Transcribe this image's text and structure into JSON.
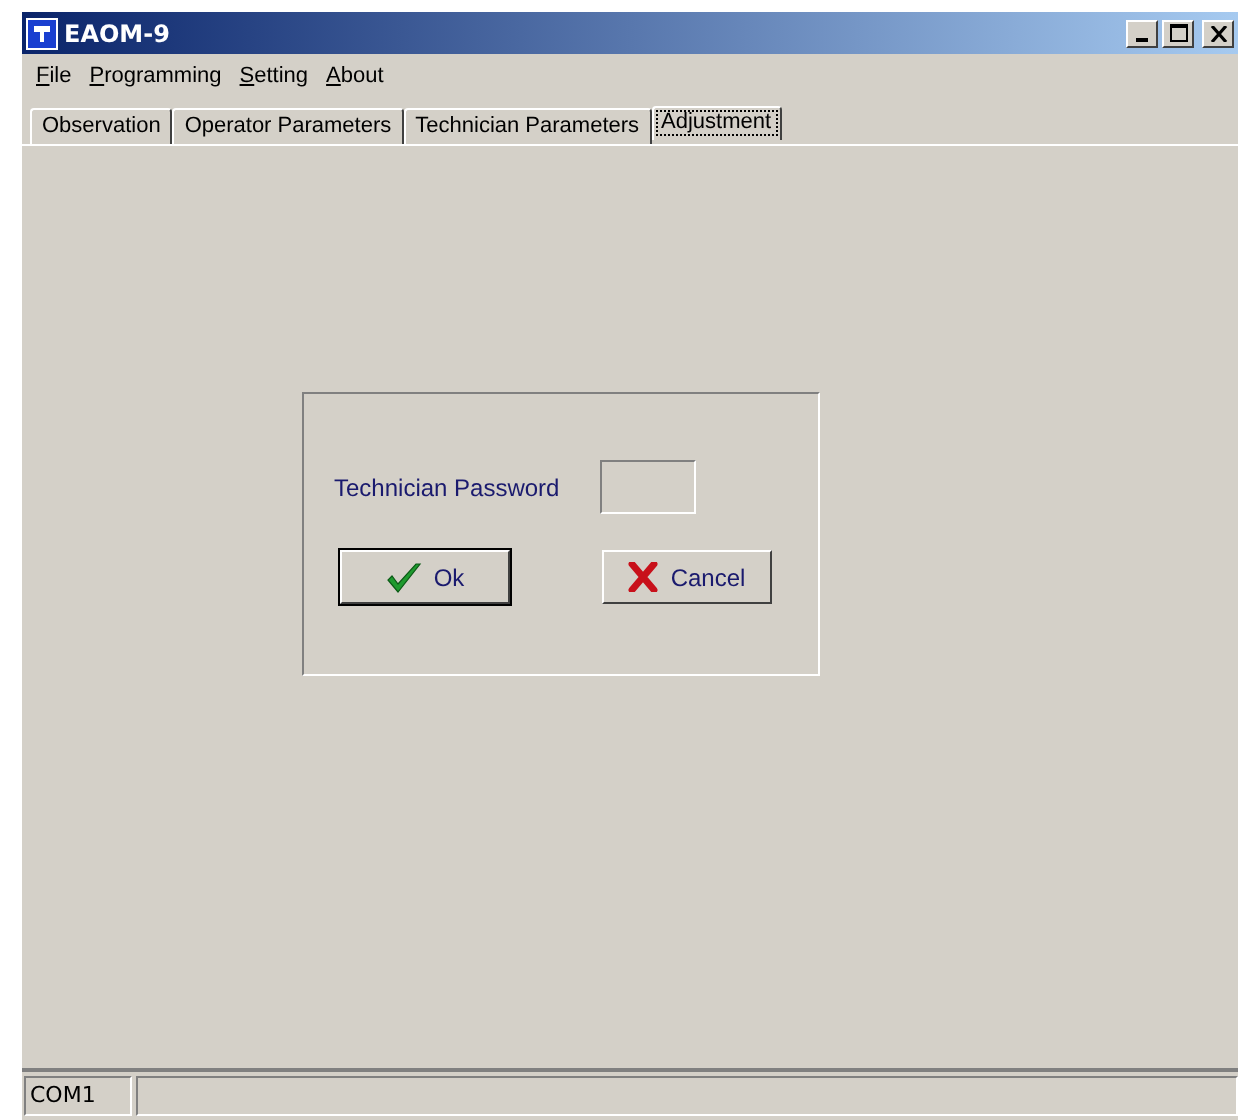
{
  "window": {
    "title": "EAOM-9"
  },
  "menu": [
    "File",
    "Programming",
    "Setting",
    "About"
  ],
  "tabs": [
    {
      "label": "Observation",
      "selected": false
    },
    {
      "label": "Operator Parameters",
      "selected": false
    },
    {
      "label": "Technician Parameters",
      "selected": false
    },
    {
      "label": "Adjustment",
      "selected": true
    }
  ],
  "dialog": {
    "label": "Technician Password",
    "buttons": [
      {
        "label": "Ok",
        "kind": "ok"
      },
      {
        "label": "Cancel",
        "kind": "cancel"
      }
    ]
  },
  "status_bar": [
    "COM1"
  ]
}
